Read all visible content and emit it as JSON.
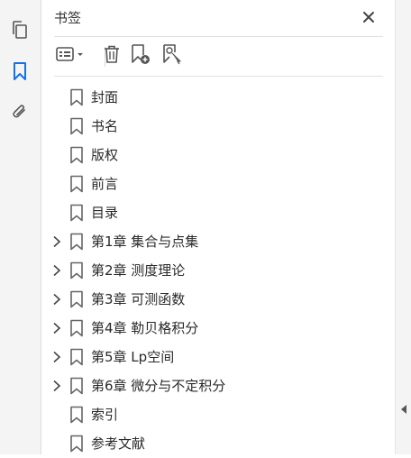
{
  "panel": {
    "title": "书签"
  },
  "bookmarks": [
    {
      "label": "封面",
      "expandable": false
    },
    {
      "label": "书名",
      "expandable": false
    },
    {
      "label": "版权",
      "expandable": false
    },
    {
      "label": "前言",
      "expandable": false
    },
    {
      "label": "目录",
      "expandable": false
    },
    {
      "label": "第1章  集合与点集",
      "expandable": true
    },
    {
      "label": "第2章  测度理论",
      "expandable": true
    },
    {
      "label": "第3章  可测函数",
      "expandable": true
    },
    {
      "label": "第4章  勒贝格积分",
      "expandable": true
    },
    {
      "label": "第5章  Lp空间",
      "expandable": true
    },
    {
      "label": "第6章  微分与不定积分",
      "expandable": true
    },
    {
      "label": "索引",
      "expandable": false
    },
    {
      "label": "参考文献",
      "expandable": false
    }
  ],
  "colors": {
    "accent": "#1473e6",
    "icon": "#555555"
  },
  "icons": [
    "pages-icon",
    "bookmark-icon",
    "paperclip-icon",
    "close-icon",
    "options-list-icon",
    "trash-icon",
    "new-bookmark-icon",
    "bookmark-search-icon",
    "chevron-right-icon",
    "collapse-arrow-icon"
  ]
}
